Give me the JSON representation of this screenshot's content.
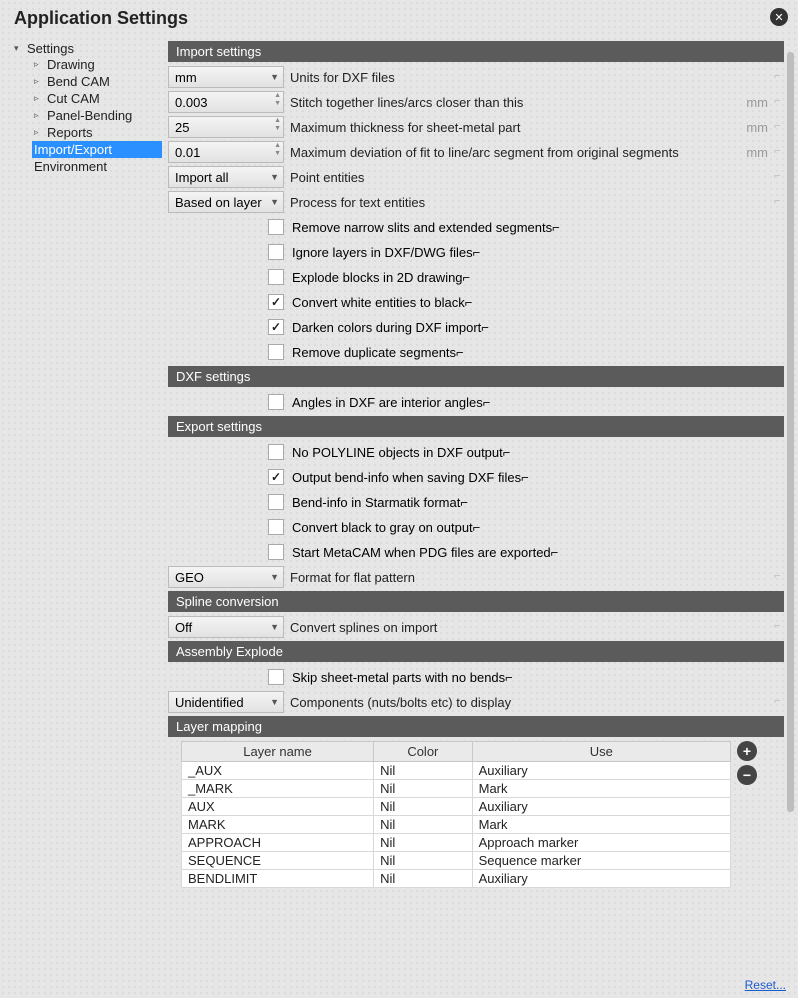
{
  "title": "Application Settings",
  "sidebar": {
    "root": "Settings",
    "items": [
      {
        "label": "Drawing"
      },
      {
        "label": "Bend CAM"
      },
      {
        "label": "Cut CAM"
      },
      {
        "label": "Panel-Bending"
      },
      {
        "label": "Reports"
      },
      {
        "label": "Import/Export",
        "selected": true
      },
      {
        "label": "Environment"
      }
    ]
  },
  "sections": {
    "import": {
      "header": "Import settings",
      "units_value": "mm",
      "units_label": "Units for DXF files",
      "stitch_value": "0.003",
      "stitch_label": "Stitch together lines/arcs closer than this",
      "stitch_unit": "mm",
      "maxthick_value": "25",
      "maxthick_label": "Maximum thickness for sheet-metal part",
      "maxthick_unit": "mm",
      "maxdev_value": "0.01",
      "maxdev_label": "Maximum deviation of fit to line/arc segment from original segments",
      "maxdev_unit": "mm",
      "point_value": "Import all",
      "point_label": "Point entities",
      "text_value": "Based on layer",
      "text_label": "Process for text entities",
      "checks": [
        {
          "label": "Remove narrow slits and extended segments",
          "checked": false
        },
        {
          "label": "Ignore layers in DXF/DWG files",
          "checked": false
        },
        {
          "label": "Explode blocks in 2D drawing",
          "checked": false
        },
        {
          "label": "Convert white entities to black",
          "checked": true
        },
        {
          "label": "Darken colors during DXF import",
          "checked": true
        },
        {
          "label": "Remove duplicate segments",
          "checked": false
        }
      ]
    },
    "dxf": {
      "header": "DXF settings",
      "checks": [
        {
          "label": "Angles in DXF are interior angles",
          "checked": false
        }
      ]
    },
    "export": {
      "header": "Export settings",
      "checks": [
        {
          "label": "No POLYLINE objects in DXF output",
          "checked": false
        },
        {
          "label": "Output bend-info when saving DXF files",
          "checked": true
        },
        {
          "label": "Bend-info in Starmatik format",
          "checked": false
        },
        {
          "label": "Convert black to gray on output",
          "checked": false
        },
        {
          "label": "Start MetaCAM when PDG files are exported",
          "checked": false
        }
      ],
      "format_value": "GEO",
      "format_label": "Format for flat pattern"
    },
    "spline": {
      "header": "Spline conversion",
      "value": "Off",
      "label": "Convert splines on import"
    },
    "assembly": {
      "header": "Assembly Explode",
      "checks": [
        {
          "label": "Skip sheet-metal parts with no bends",
          "checked": false
        }
      ],
      "comp_value": "Unidentified",
      "comp_label": "Components (nuts/bolts etc) to display"
    },
    "layer": {
      "header": "Layer mapping",
      "columns": [
        "Layer name",
        "Color",
        "Use"
      ],
      "rows": [
        {
          "name": "_AUX",
          "color": "Nil",
          "use": "Auxiliary"
        },
        {
          "name": "_MARK",
          "color": "Nil",
          "use": "Mark"
        },
        {
          "name": "AUX",
          "color": "Nil",
          "use": "Auxiliary"
        },
        {
          "name": "MARK",
          "color": "Nil",
          "use": "Mark"
        },
        {
          "name": "APPROACH",
          "color": "Nil",
          "use": "Approach marker"
        },
        {
          "name": "SEQUENCE",
          "color": "Nil",
          "use": "Sequence marker"
        },
        {
          "name": "BENDLIMIT",
          "color": "Nil",
          "use": "Auxiliary"
        }
      ]
    }
  },
  "reset": "Reset..."
}
